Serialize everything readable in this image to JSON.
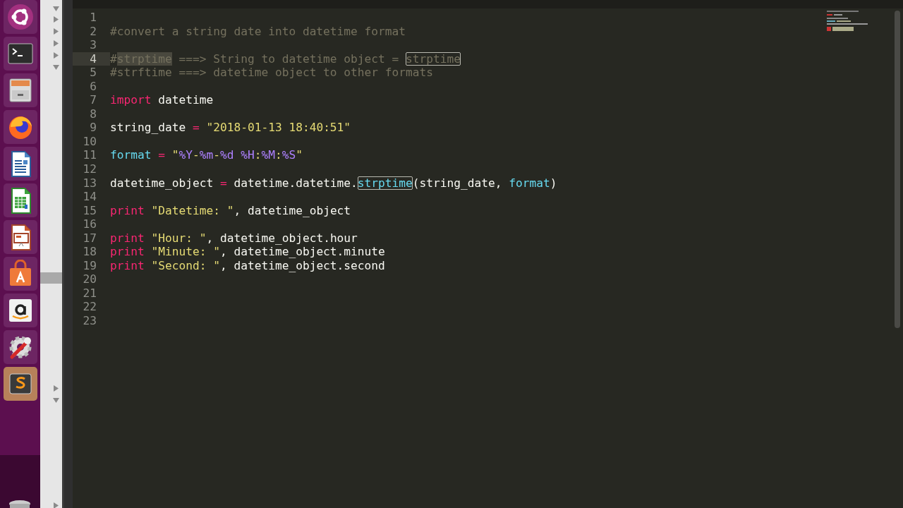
{
  "launcher": {
    "items": [
      {
        "kind": "ubuntu",
        "selected": false
      },
      {
        "kind": "terminal",
        "selected": false
      },
      {
        "kind": "files",
        "selected": false
      },
      {
        "kind": "firefox",
        "selected": false
      },
      {
        "kind": "writer",
        "selected": false
      },
      {
        "kind": "calc",
        "selected": false
      },
      {
        "kind": "impress",
        "selected": false
      },
      {
        "kind": "software",
        "selected": false
      },
      {
        "kind": "amazon",
        "selected": false
      },
      {
        "kind": "settings",
        "selected": false
      },
      {
        "kind": "sublime",
        "selected": true
      }
    ]
  },
  "editor": {
    "lines": [
      {
        "number": "1",
        "current": false
      },
      {
        "number": "2",
        "current": false,
        "tokens": [
          {
            "text": "#convert a string date into datetime format",
            "kind": "comment"
          }
        ]
      },
      {
        "number": "3",
        "current": false
      },
      {
        "number": "4",
        "current": true,
        "tokens": [
          {
            "text": "#",
            "kind": "comment"
          },
          {
            "text": "strptime",
            "kind": "comment-selected"
          },
          {
            "text": " ===> String to datetime object = ",
            "kind": "comment"
          },
          {
            "text": "strptime",
            "kind": "comment-boxed"
          }
        ]
      },
      {
        "number": "5",
        "current": false,
        "tokens": [
          {
            "text": "#strftime ===> datetime object to other formats",
            "kind": "comment"
          }
        ]
      },
      {
        "number": "6",
        "current": false
      },
      {
        "number": "7",
        "current": false,
        "tokens": [
          {
            "text": "import",
            "kind": "keyword"
          },
          {
            "text": " datetime",
            "kind": "plain"
          }
        ]
      },
      {
        "number": "8",
        "current": false
      },
      {
        "number": "9",
        "current": false,
        "tokens": [
          {
            "text": "string_date ",
            "kind": "plain"
          },
          {
            "text": "=",
            "kind": "keyword"
          },
          {
            "text": " \"2018-01-13 18:40:51\"",
            "kind": "string"
          }
        ]
      },
      {
        "number": "10",
        "current": false
      },
      {
        "number": "11",
        "current": false,
        "tokens": [
          {
            "text": "format",
            "kind": "support"
          },
          {
            "text": " = ",
            "kind": "keyword"
          },
          {
            "text": "\"",
            "kind": "string"
          },
          {
            "text": "%Y",
            "kind": "format-code"
          },
          {
            "text": "-",
            "kind": "string"
          },
          {
            "text": "%m",
            "kind": "format-code"
          },
          {
            "text": "-",
            "kind": "string"
          },
          {
            "text": "%d",
            "kind": "format-code"
          },
          {
            "text": " %H",
            "kind": "format-code"
          },
          {
            "text": ":",
            "kind": "string"
          },
          {
            "text": "%M",
            "kind": "format-code"
          },
          {
            "text": ":",
            "kind": "string"
          },
          {
            "text": "%S",
            "kind": "format-code"
          },
          {
            "text": "\"",
            "kind": "string"
          }
        ]
      },
      {
        "number": "12",
        "current": false
      },
      {
        "number": "13",
        "current": false,
        "tokens": [
          {
            "text": "datetime_object ",
            "kind": "plain"
          },
          {
            "text": "=",
            "kind": "keyword"
          },
          {
            "text": " datetime.datetime.",
            "kind": "plain"
          },
          {
            "text": "strptime",
            "kind": "support-boxed"
          },
          {
            "text": "(string_date, ",
            "kind": "plain"
          },
          {
            "text": "format",
            "kind": "support"
          },
          {
            "text": ")",
            "kind": "plain"
          }
        ]
      },
      {
        "number": "14",
        "current": false
      },
      {
        "number": "15",
        "current": false,
        "tokens": [
          {
            "text": "print",
            "kind": "keyword"
          },
          {
            "text": " \"Datetime: \"",
            "kind": "string"
          },
          {
            "text": ", datetime_object",
            "kind": "plain"
          }
        ]
      },
      {
        "number": "16",
        "current": false
      },
      {
        "number": "17",
        "current": false,
        "tokens": [
          {
            "text": "print",
            "kind": "keyword"
          },
          {
            "text": " \"Hour: \"",
            "kind": "string"
          },
          {
            "text": ", datetime_object.hour",
            "kind": "plain"
          }
        ]
      },
      {
        "number": "18",
        "current": false,
        "tokens": [
          {
            "text": "print",
            "kind": "keyword"
          },
          {
            "text": " \"Minute: \"",
            "kind": "string"
          },
          {
            "text": ", datetime_object.minute",
            "kind": "plain"
          }
        ]
      },
      {
        "number": "19",
        "current": false,
        "tokens": [
          {
            "text": "print",
            "kind": "keyword"
          },
          {
            "text": " \"Second: \"",
            "kind": "string"
          },
          {
            "text": ", datetime_object.second",
            "kind": "plain"
          }
        ]
      },
      {
        "number": "20",
        "current": false
      },
      {
        "number": "21",
        "current": false
      },
      {
        "number": "22",
        "current": false
      },
      {
        "number": "23",
        "current": false
      }
    ]
  }
}
